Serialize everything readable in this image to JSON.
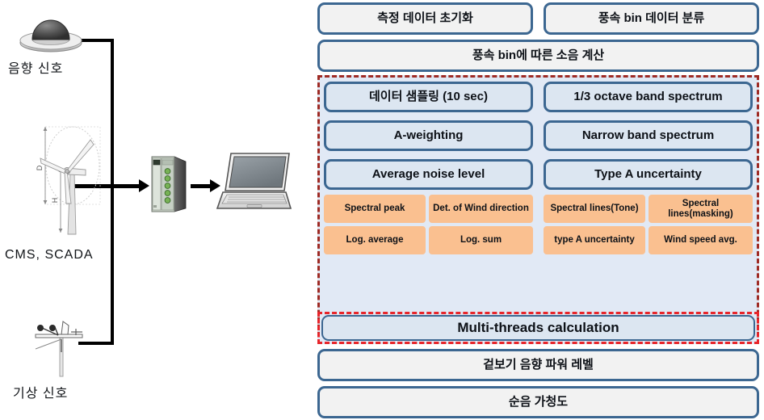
{
  "left_panel": {
    "sources": [
      {
        "id": "acoustic",
        "label": "음향 신호",
        "icon": "microphone-ground-plane-icon"
      },
      {
        "id": "turbine",
        "label": "CMS, SCADA",
        "icon": "wind-turbine-icon"
      },
      {
        "id": "met",
        "label": "기상 신호",
        "icon": "anemometer-icon"
      }
    ],
    "turbine_dimension_labels": {
      "diameter": "D",
      "height": "H"
    },
    "devices": [
      {
        "id": "daq",
        "icon": "daq-chassis-icon"
      },
      {
        "id": "laptop",
        "icon": "laptop-icon"
      }
    ]
  },
  "right_panel": {
    "top_row": [
      {
        "id": "init",
        "label": "측정 데이터 초기화"
      },
      {
        "id": "binning",
        "label": "풍속 bin 데이터 분류"
      }
    ],
    "full_row_top": {
      "id": "noise-calc",
      "label": "풍속 bin에 따른 소음 계산"
    },
    "thread_group": {
      "left_column": [
        {
          "id": "sampling",
          "label": "데이터 샘플링 (10 sec)"
        },
        {
          "id": "aweighting",
          "label": "A-weighting"
        },
        {
          "id": "avgnoise",
          "label": "Average noise level"
        }
      ],
      "right_column": [
        {
          "id": "thirdoctave",
          "label": "1/3 octave band spectrum"
        },
        {
          "id": "narrowband",
          "label": "Narrow band spectrum"
        },
        {
          "id": "typea",
          "label": "Type A uncertainty"
        }
      ],
      "subtasks_row1": [
        {
          "id": "spectral-peak",
          "label": "Spectral peak"
        },
        {
          "id": "det-wind-direction",
          "label": "Det. of Wind direction"
        },
        {
          "id": "spectral-lines-tone",
          "label": "Spectral lines(Tone)"
        },
        {
          "id": "spectral-lines-mask",
          "label": "Spectral lines(masking)"
        }
      ],
      "subtasks_row2": [
        {
          "id": "log-average",
          "label": "Log. average"
        },
        {
          "id": "log-sum",
          "label": "Log. sum"
        },
        {
          "id": "type-a-uncert",
          "label": "type A uncertainty"
        },
        {
          "id": "wind-speed-avg",
          "label": "Wind speed avg."
        }
      ],
      "arrow": {
        "id": "down-arrow",
        "icon": "down-arrow-icon"
      },
      "result": {
        "id": "multithreads",
        "label": "Multi-threads calculation"
      }
    },
    "bottom_rows": [
      {
        "id": "apparent-power",
        "label": "겉보기 음향 파워 레벨"
      },
      {
        "id": "tonality",
        "label": "순음 가청도"
      }
    ]
  },
  "colors": {
    "box_border": "#3c6791",
    "box_fill_gray": "#f2f2f2",
    "box_fill_blue": "#dce6f1",
    "subtask_fill": "#fac090",
    "group_dashed_border": "#9e2b25",
    "highlight_dashed_border": "#e8252a",
    "group_background": "#e1e9f5",
    "arrow_fill": "#4f81bd",
    "wire": "#000000"
  }
}
